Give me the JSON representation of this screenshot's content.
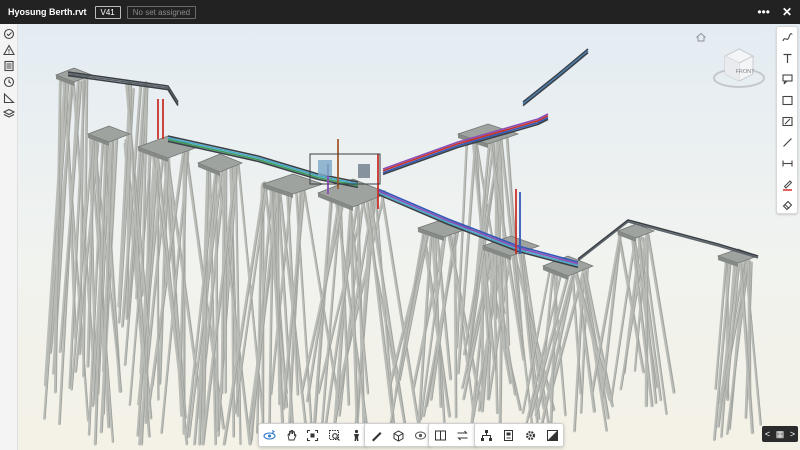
{
  "header": {
    "file_name": "Hyosung Berth.rvt",
    "version": "V41",
    "set_status": "No set assigned",
    "more_label": "•••",
    "close_label": "✕"
  },
  "left_toolbar": [
    {
      "name": "issues-icon"
    },
    {
      "name": "warning-icon"
    },
    {
      "name": "sheets-icon"
    },
    {
      "name": "history-icon"
    },
    {
      "name": "measure-icon"
    },
    {
      "name": "layers-icon"
    }
  ],
  "view_cube": {
    "face_label": "FRONT"
  },
  "right_toolbar": [
    {
      "name": "freehand-icon"
    },
    {
      "name": "text-icon"
    },
    {
      "name": "callout-icon"
    },
    {
      "name": "rectangle-icon"
    },
    {
      "name": "polycloud-icon"
    },
    {
      "name": "line-icon"
    },
    {
      "name": "dimension-icon"
    },
    {
      "name": "pen-color-icon"
    },
    {
      "name": "eraser-icon"
    }
  ],
  "bottom_toolbar_groups": [
    [
      "orbit-icon",
      "pan-icon",
      "fit-view-icon",
      "zoom-window-icon",
      "first-person-icon"
    ],
    [
      "measure-tool-icon",
      "section-box-icon",
      "explode-icon"
    ],
    [
      "split-view-icon",
      "compare-icon"
    ],
    [
      "model-browser-icon",
      "properties-icon",
      "settings-icon",
      "fullscreen-icon"
    ]
  ],
  "pager": {
    "prev": "<",
    "grid": "▦",
    "next": ">"
  },
  "colors": {
    "header_bg": "#222222",
    "pile": "#b9bbb6",
    "deck": "#9fa3a0",
    "pipe_red": "#c8322a",
    "pipe_blue": "#3358b8",
    "pipe_purple": "#8a4fb6",
    "pipe_cyan": "#47a8c9",
    "pipe_green": "#3d9a5a",
    "steel_dark": "#3a4046"
  }
}
